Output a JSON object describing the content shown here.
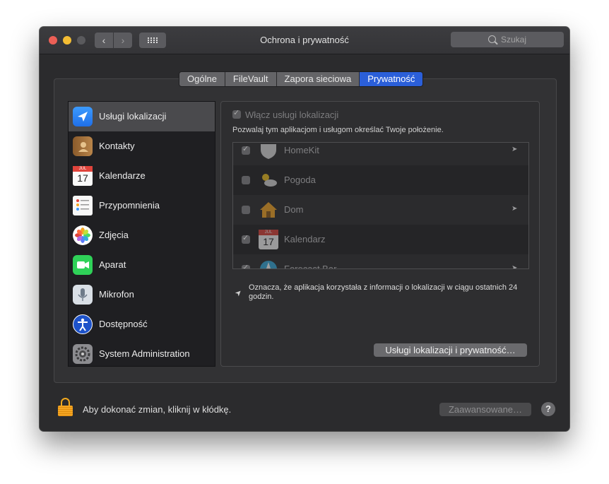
{
  "window": {
    "title": "Ochrona i prywatność"
  },
  "search": {
    "placeholder": "Szukaj"
  },
  "tabs": [
    {
      "label": "Ogólne",
      "active": false
    },
    {
      "label": "FileVault",
      "active": false
    },
    {
      "label": "Zapora sieciowa",
      "active": false
    },
    {
      "label": "Prywatność",
      "active": true
    }
  ],
  "sidebar": {
    "items": [
      {
        "label": "Usługi lokalizacji",
        "icon": "location-arrow-icon",
        "selected": true
      },
      {
        "label": "Kontakty",
        "icon": "contacts-book-icon"
      },
      {
        "label": "Kalendarze",
        "icon": "calendar-icon"
      },
      {
        "label": "Przypomnienia",
        "icon": "reminders-icon"
      },
      {
        "label": "Zdjęcia",
        "icon": "photos-icon"
      },
      {
        "label": "Aparat",
        "icon": "camera-icon"
      },
      {
        "label": "Mikrofon",
        "icon": "microphone-icon"
      },
      {
        "label": "Dostępność",
        "icon": "accessibility-icon"
      },
      {
        "label": "System Administration",
        "icon": "gear-icon"
      }
    ]
  },
  "location": {
    "enable_label": "Włącz usługi lokalizacji",
    "enable_checked": true,
    "description": "Pozwalaj tym aplikacjom i usługom określać Twoje położenie.",
    "apps": [
      {
        "name": "HomeKit",
        "checked": true,
        "arrow": true,
        "icon": "homekit-shield-icon"
      },
      {
        "name": "Pogoda",
        "checked": false,
        "arrow": false,
        "icon": "weather-icon"
      },
      {
        "name": "Dom",
        "checked": false,
        "arrow": true,
        "icon": "home-icon"
      },
      {
        "name": "Kalendarz",
        "checked": true,
        "arrow": false,
        "icon": "calendar-icon"
      },
      {
        "name": "Forecast Bar",
        "checked": true,
        "arrow": true,
        "icon": "compass-icon"
      }
    ],
    "note": "Oznacza, że aplikacja korzystała z informacji o lokalizacji w ciągu ostatnich 24 godzin.",
    "privacy_button": "Usługi lokalizacji i prywatność…"
  },
  "calendar_icon": {
    "month": "JUL",
    "day": "17"
  },
  "footer": {
    "lock_text": "Aby dokonać zmian, kliknij w kłódkę.",
    "advanced_button": "Zaawansowane…",
    "help_label": "?"
  }
}
